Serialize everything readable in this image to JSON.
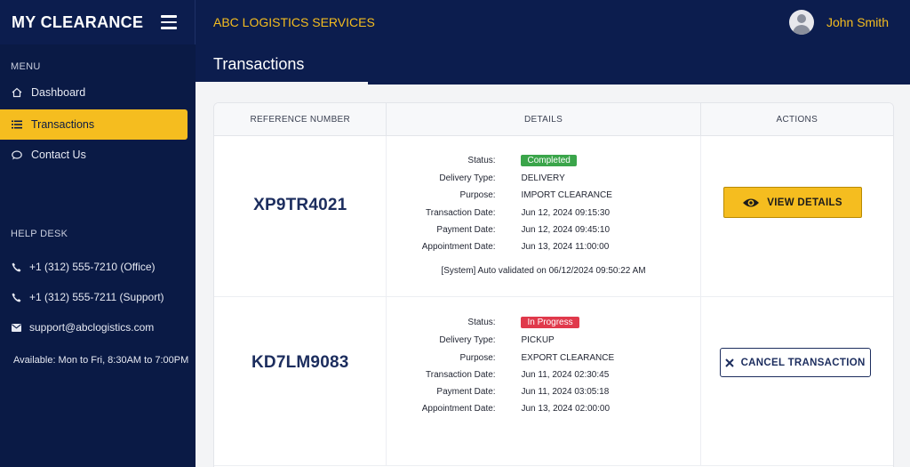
{
  "app": {
    "title": "MY CLEARANCE",
    "company": "ABC LOGISTICS SERVICES",
    "user_name": "John Smith"
  },
  "sidebar": {
    "menu_label": "MENU",
    "items": [
      {
        "label": "Dashboard",
        "icon": "home-icon"
      },
      {
        "label": "Transactions",
        "icon": "list-icon",
        "active": true
      },
      {
        "label": "Contact Us",
        "icon": "chat-icon"
      }
    ],
    "help_label": "HELP DESK",
    "help_items": [
      {
        "label": "+1 (312) 555-7210 (Office)",
        "icon": "phone-icon"
      },
      {
        "label": "+1 (312) 555-7211 (Support)",
        "icon": "phone-icon"
      },
      {
        "label": "support@abclogistics.com",
        "icon": "mail-icon"
      }
    ],
    "availability": "Available: Mon to Fri, 8:30AM to 7:00PM"
  },
  "page": {
    "title": "Transactions"
  },
  "table": {
    "headers": [
      "REFERENCE NUMBER",
      "DETAILS",
      "ACTIONS"
    ],
    "rows": [
      {
        "reference": "XP9TR4021",
        "details": [
          {
            "label": "Status:",
            "value": "Completed"
          },
          {
            "label": "Delivery Type:",
            "value": "DELIVERY"
          },
          {
            "label": "Purpose:",
            "value": "IMPORT CLEARANCE"
          },
          {
            "label": "Transaction Date:",
            "value": "Jun 12, 2024 09:15:30"
          },
          {
            "label": "Payment Date:",
            "value": "Jun 12, 2024 09:45:10"
          },
          {
            "label": "Appointment Date:",
            "value": "Jun 13, 2024 11:00:00"
          }
        ],
        "note": "[System] Auto validated on 06/12/2024 09:50:22 AM",
        "action": "VIEW DETAILS",
        "status_color": "#3aa54a"
      },
      {
        "reference": "KD7LM9083",
        "details": [
          {
            "label": "Status:",
            "value": "In Progress"
          },
          {
            "label": "Delivery Type:",
            "value": "PICKUP"
          },
          {
            "label": "Purpose:",
            "value": "EXPORT CLEARANCE"
          },
          {
            "label": "Transaction Date:",
            "value": "Jun 11, 2024 02:30:45"
          },
          {
            "label": "Payment Date:",
            "value": "Jun 11, 2024 03:05:18"
          },
          {
            "label": "Appointment Date:",
            "value": "Jun 13, 2024 02:00:00"
          }
        ],
        "action": "CANCEL TRANSACTION",
        "status_color": "#e0394b"
      }
    ]
  },
  "colors": {
    "navy": "#0c1d4e",
    "accent": "#f5bd1f"
  }
}
